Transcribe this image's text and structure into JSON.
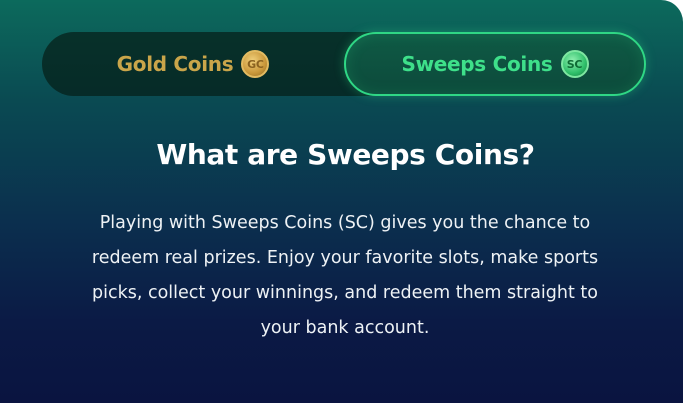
{
  "tabs": {
    "gold": {
      "label": "Gold Coins",
      "badge": "GC",
      "icon": "gold-coin-icon",
      "selected": false
    },
    "sweeps": {
      "label": "Sweeps Coins",
      "badge": "SC",
      "icon": "sweeps-coin-icon",
      "selected": true
    }
  },
  "content": {
    "heading": "What are Sweeps Coins?",
    "description": "Playing with Sweeps Coins (SC) gives you the chance to redeem real prizes. Enjoy your favorite slots, make sports picks, collect your winnings, and redeem them straight to your bank account."
  },
  "colors": {
    "accent_green": "#2fd785",
    "gold": "#c9a54a"
  }
}
